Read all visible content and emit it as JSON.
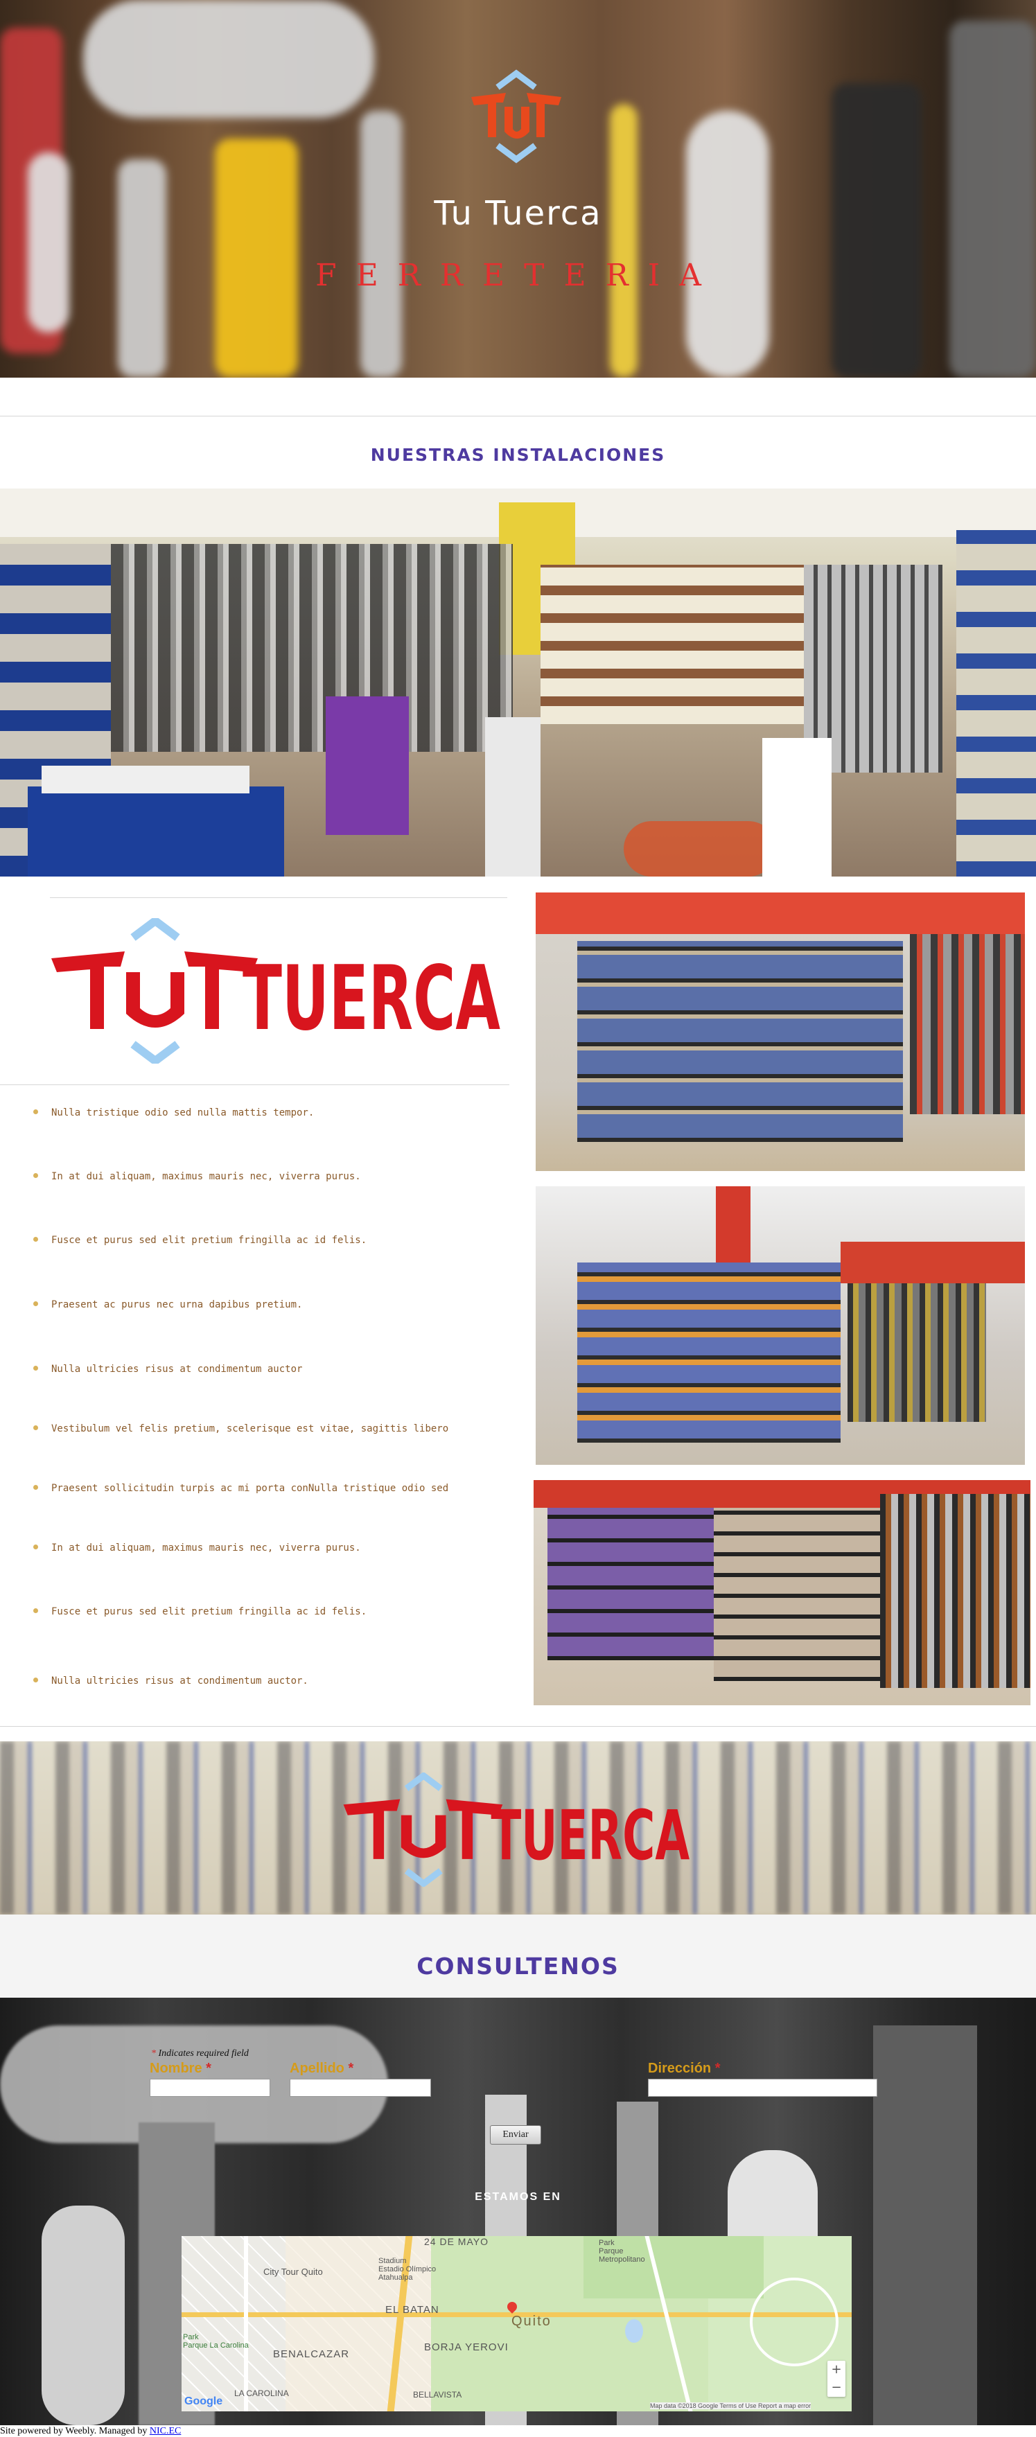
{
  "hero": {
    "title": "Tu Tuerca",
    "subtitle": "FERRETERIA"
  },
  "sections": {
    "installations_title": "NUESTRAS INSTALACIONES",
    "contact_title": "CONSULTENOS",
    "map_title": "ESTAMOS EN"
  },
  "brand": {
    "logo_text": "TUERCA",
    "logo_prefix": "Tu",
    "primary_color": "#d8151e",
    "accent_color": "#9ecdf2"
  },
  "features": [
    "Nulla tristique odio sed nulla mattis tempor.",
    "In at dui aliquam, maximus mauris nec, viverra purus.",
    "Fusce et purus sed elit pretium fringilla ac id felis.",
    "Praesent ac purus nec urna dapibus pretium.",
    "Nulla ultricies risus at condimentum auctor",
    "Vestibulum vel felis pretium, scelerisque est vitae, sagittis libero",
    "Praesent sollicitudin turpis ac mi porta conNulla tristique odio sed",
    "In at dui aliquam, maximus mauris nec, viverra purus.",
    "Fusce et purus sed elit pretium fringilla ac id felis.",
    "Nulla ultricies risus at condimentum auctor."
  ],
  "form": {
    "required_note": "Indicates required field",
    "required_mark": "*",
    "fields": {
      "nombre": "Nombre",
      "apellido": "Apellido",
      "direccion": "Dirección"
    },
    "submit_label": "Enviar"
  },
  "map": {
    "labels": {
      "city_tour": "City Tour Quito",
      "stadium": "Stadium\nEstadio Olímpico\nAtahualpa",
      "park_top": "Park\nParque\nMetropolitano",
      "el_batan": "EL BATAN",
      "park": "Park\nParque La Carolina",
      "benalcazar": "BENALCAZAR",
      "borja": "BORJA YEROVI",
      "carolina": "LA CAROLINA",
      "bellavista": "BELLAVISTA",
      "mayo": "24 DE MAYO",
      "quito": "Quito",
      "google": "Google",
      "attribution": "Map data ©2018 Google   Terms of Use   Report a map error",
      "zoom_in": "+",
      "zoom_out": "−"
    }
  },
  "footer": {
    "text": "Site powered by Weebly. Managed by ",
    "link": "NIC.EC"
  }
}
